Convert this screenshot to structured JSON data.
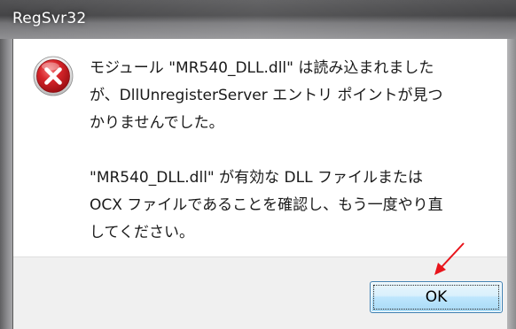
{
  "window": {
    "title": "RegSvr32"
  },
  "dialog": {
    "icon": "error-icon",
    "message_para1": "モジュール \"MR540_DLL.dll\" は読み込まれました\nが、DllUnregisterServer エントリ ポイントが見つ\nかりませんでした。",
    "message_para2": "\"MR540_DLL.dll\" が有効な DLL ファイルまたは\nOCX ファイルであることを確認し、もう一度やり直\nしてください。",
    "ok_label": "OK"
  },
  "colors": {
    "error_red": "#c4161c",
    "annotation_arrow": "#e8141b",
    "button_border": "#3c7fb1"
  }
}
